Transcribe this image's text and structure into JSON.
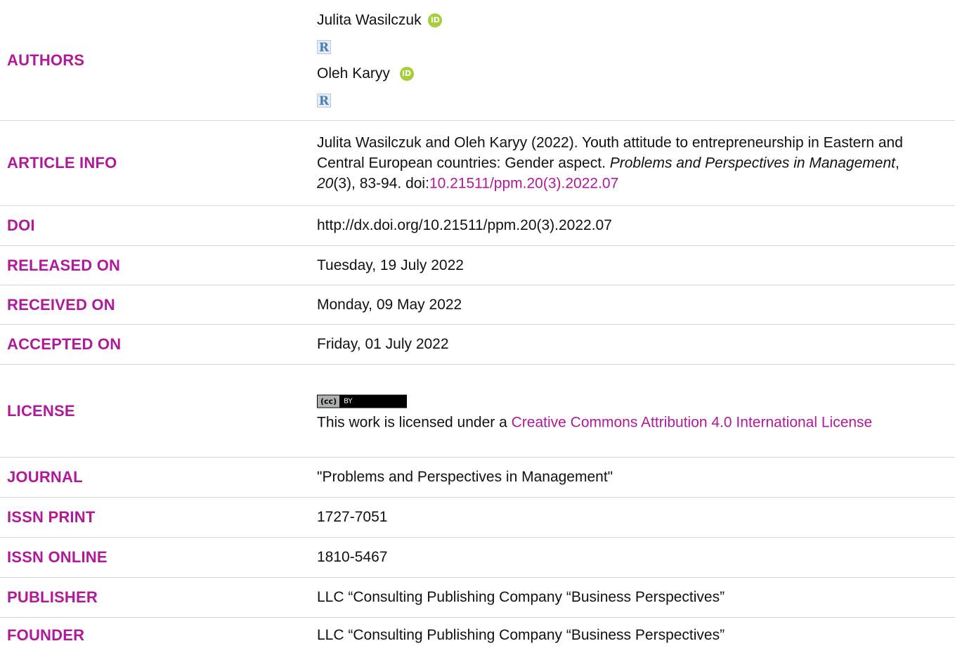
{
  "labels": {
    "authors": "AUTHORS",
    "article_info": "ARTICLE INFO",
    "doi": "DOI",
    "released_on": "RELEASED ON",
    "received_on": "RECEIVED ON",
    "accepted_on": "ACCEPTED ON",
    "license": "LICENSE",
    "journal": "JOURNAL",
    "issn_print": "ISSN PRINT",
    "issn_online": "ISSN ONLINE",
    "publisher": "PUBLISHER",
    "founder": "FOUNDER"
  },
  "authors": [
    {
      "name": "Julita Wasilczuk",
      "orcid_glyph": "iD",
      "rg_glyph": "R"
    },
    {
      "name": "Oleh Karyy",
      "orcid_glyph": "iD",
      "rg_glyph": "R"
    }
  ],
  "article_info": {
    "prefix": "Julita Wasilczuk and Oleh Karyy (2022). Youth attitude to entrepreneurship in Eastern and Central European countries: Gender aspect. ",
    "journal_italic": "Problems and Perspectives in Management",
    "sep1": ", ",
    "volume_italic": "20",
    "issue_pages": "(3), 83-94. doi:",
    "doi_link": "10.21511/ppm.20(3).2022.07"
  },
  "doi": "http://dx.doi.org/10.21511/ppm.20(3).2022.07",
  "released_on": "Tuesday, 19 July 2022",
  "received_on": "Monday, 09 May 2022",
  "accepted_on": "Friday, 01 July 2022",
  "license": {
    "badge_cc": "(cc)",
    "badge_by": "BY",
    "text_prefix": "This work is licensed under a ",
    "link_text": "Creative Commons Attribution 4.0 International License"
  },
  "journal": "\"Problems and Perspectives in Management\"",
  "issn_print": "1727-7051",
  "issn_online": "1810-5467",
  "publisher": "LLC “Consulting Publishing Company “Business Perspectives”",
  "founder": "LLC “Consulting Publishing Company “Business Perspectives”",
  "colors": {
    "label": "#b0199a",
    "link": "#b0199a",
    "orcid": "#a6ce39",
    "divider": "#d7d7d7"
  },
  "icons": {
    "orcid": "orcid-icon",
    "researchgate": "researchgate-icon",
    "license_badge": "cc-by-badge-icon"
  }
}
